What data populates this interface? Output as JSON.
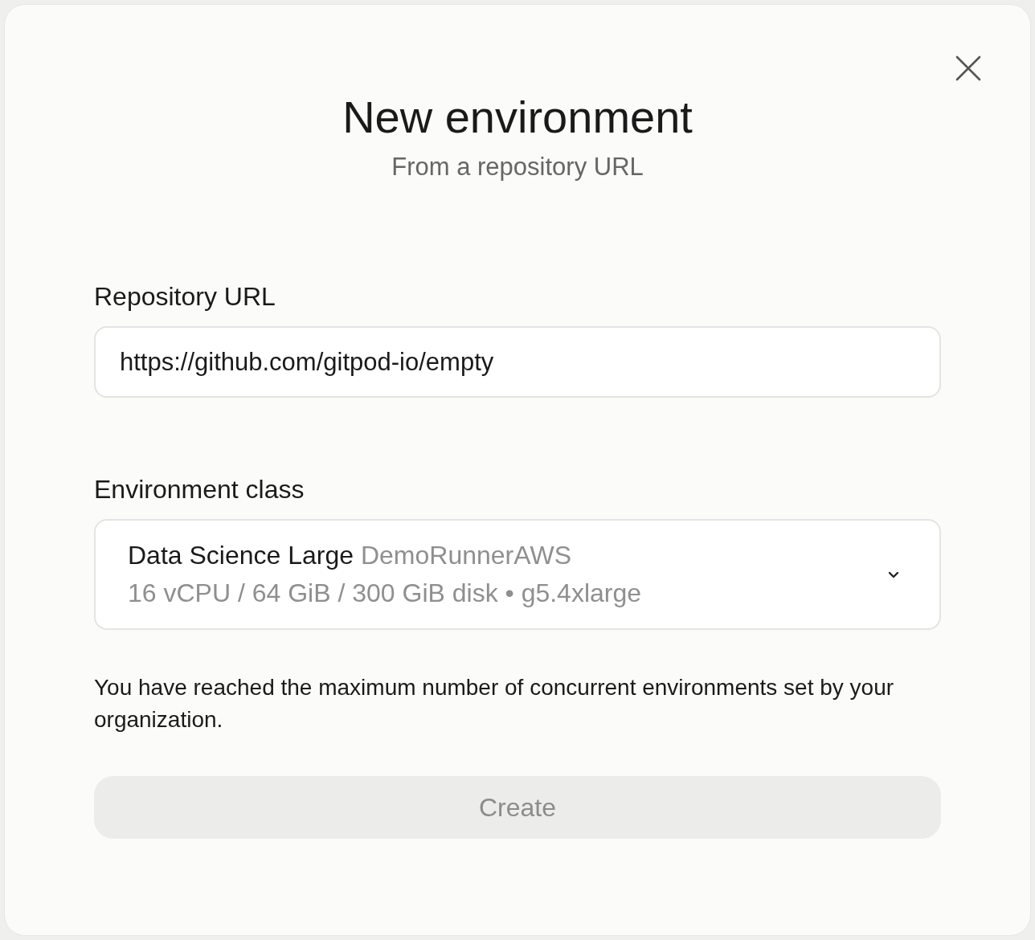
{
  "dialog": {
    "title": "New environment",
    "subtitle": "From a repository URL"
  },
  "repository": {
    "label": "Repository URL",
    "value": "https://github.com/gitpod-io/empty"
  },
  "environment_class": {
    "label": "Environment class",
    "name": "Data Science Large",
    "runner": "DemoRunnerAWS",
    "specs": "16 vCPU / 64 GiB / 300 GiB disk • g5.4xlarge",
    "expanded": false
  },
  "notice": "You have reached the maximum number of concurrent environments set by your organization.",
  "create_button": {
    "label": "Create",
    "disabled": true
  }
}
